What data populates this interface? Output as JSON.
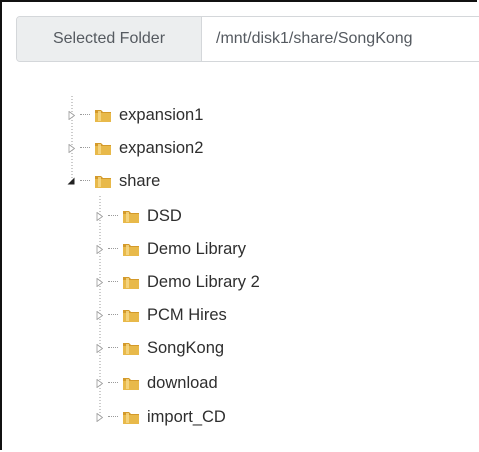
{
  "selected_folder": {
    "label": "Selected Folder",
    "path": "/mnt/disk1/share/SongKong"
  },
  "tree": {
    "root_items": [
      {
        "label": "expansion1",
        "state": "collapsed"
      },
      {
        "label": "expansion2",
        "state": "collapsed"
      },
      {
        "label": "share",
        "state": "expanded"
      }
    ],
    "share_children": [
      {
        "label": "DSD",
        "state": "collapsed"
      },
      {
        "label": "Demo Library",
        "state": "collapsed"
      },
      {
        "label": "Demo Library 2",
        "state": "collapsed"
      },
      {
        "label": "PCM Hires",
        "state": "collapsed"
      },
      {
        "label": "SongKong",
        "state": "collapsed"
      },
      {
        "label": "download",
        "state": "collapsed"
      },
      {
        "label": "import_CD",
        "state": "collapsed"
      }
    ]
  },
  "colors": {
    "folder_fill": "#e8b94a",
    "folder_tab": "#d49a2a",
    "label_text": "#2e2e2e",
    "guide_line": "#9a9a9a"
  },
  "icons": {
    "folder": "folder-icon",
    "collapsed_toggle": "triangle-right-icon",
    "expanded_toggle": "triangle-down-icon"
  }
}
